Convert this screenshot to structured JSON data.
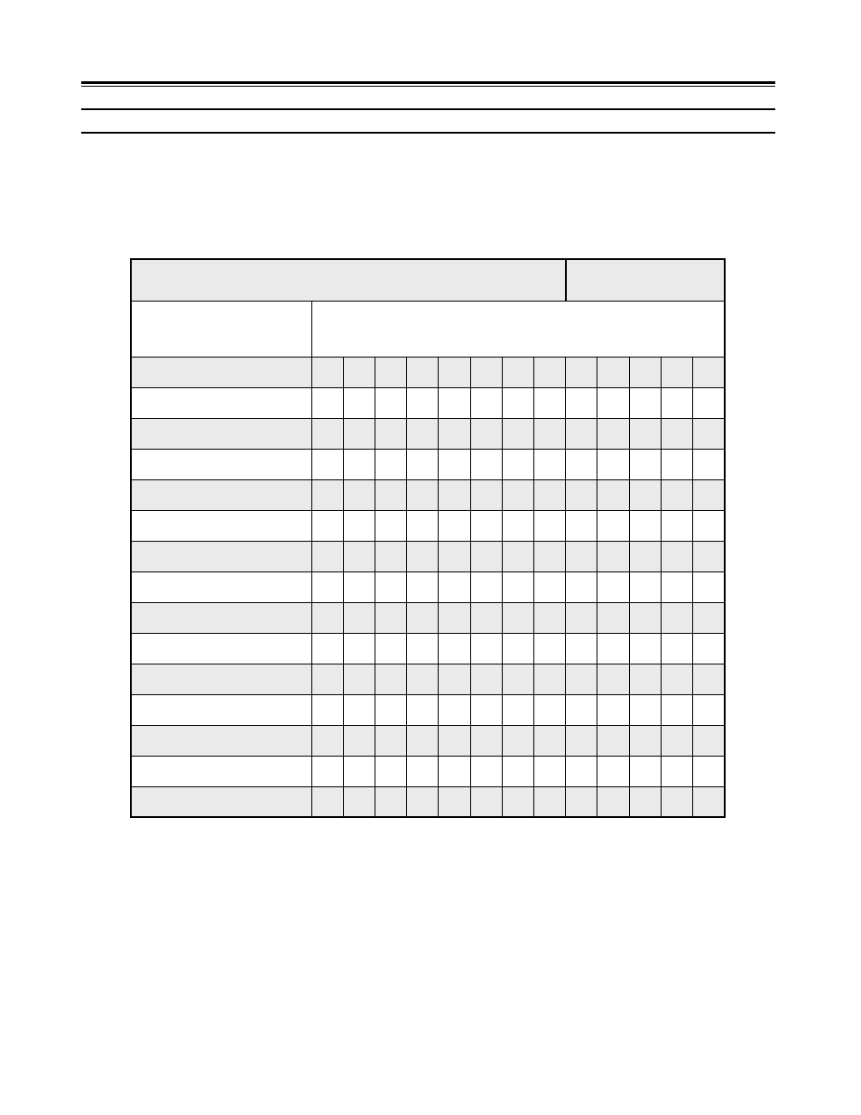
{
  "rules": {
    "double": "",
    "single1": "",
    "single2": ""
  },
  "table": {
    "header": {
      "title_left": "",
      "title_right": ""
    },
    "subheader": {
      "row_label": "",
      "columns_label": ""
    },
    "rows": [
      {
        "label": "",
        "cells": [
          "",
          "",
          "",
          "",
          "",
          "",
          "",
          "",
          "",
          "",
          "",
          "",
          ""
        ]
      },
      {
        "label": "",
        "cells": [
          "",
          "",
          "",
          "",
          "",
          "",
          "",
          "",
          "",
          "",
          "",
          "",
          ""
        ]
      },
      {
        "label": "",
        "cells": [
          "",
          "",
          "",
          "",
          "",
          "",
          "",
          "",
          "",
          "",
          "",
          "",
          ""
        ]
      },
      {
        "label": "",
        "cells": [
          "",
          "",
          "",
          "",
          "",
          "",
          "",
          "",
          "",
          "",
          "",
          "",
          ""
        ]
      },
      {
        "label": "",
        "cells": [
          "",
          "",
          "",
          "",
          "",
          "",
          "",
          "",
          "",
          "",
          "",
          "",
          ""
        ]
      },
      {
        "label": "",
        "cells": [
          "",
          "",
          "",
          "",
          "",
          "",
          "",
          "",
          "",
          "",
          "",
          "",
          ""
        ]
      },
      {
        "label": "",
        "cells": [
          "",
          "",
          "",
          "",
          "",
          "",
          "",
          "",
          "",
          "",
          "",
          "",
          ""
        ]
      },
      {
        "label": "",
        "cells": [
          "",
          "",
          "",
          "",
          "",
          "",
          "",
          "",
          "",
          "",
          "",
          "",
          ""
        ]
      },
      {
        "label": "",
        "cells": [
          "",
          "",
          "",
          "",
          "",
          "",
          "",
          "",
          "",
          "",
          "",
          "",
          ""
        ]
      },
      {
        "label": "",
        "cells": [
          "",
          "",
          "",
          "",
          "",
          "",
          "",
          "",
          "",
          "",
          "",
          "",
          ""
        ]
      },
      {
        "label": "",
        "cells": [
          "",
          "",
          "",
          "",
          "",
          "",
          "",
          "",
          "",
          "",
          "",
          "",
          ""
        ]
      },
      {
        "label": "",
        "cells": [
          "",
          "",
          "",
          "",
          "",
          "",
          "",
          "",
          "",
          "",
          "",
          "",
          ""
        ]
      },
      {
        "label": "",
        "cells": [
          "",
          "",
          "",
          "",
          "",
          "",
          "",
          "",
          "",
          "",
          "",
          "",
          ""
        ]
      },
      {
        "label": "",
        "cells": [
          "",
          "",
          "",
          "",
          "",
          "",
          "",
          "",
          "",
          "",
          "",
          "",
          ""
        ]
      },
      {
        "label": "",
        "cells": [
          "",
          "",
          "",
          "",
          "",
          "",
          "",
          "",
          "",
          "",
          "",
          "",
          ""
        ]
      }
    ]
  }
}
